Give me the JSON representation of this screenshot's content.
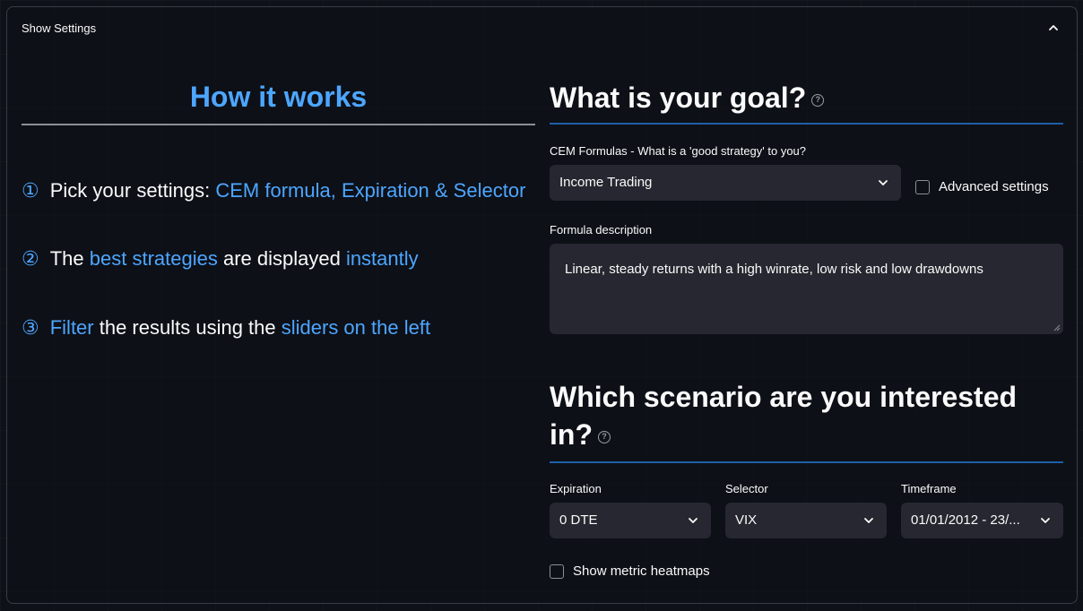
{
  "settings_panel": {
    "title": "Show Settings"
  },
  "how": {
    "title": "How it works",
    "steps": [
      {
        "num": "①",
        "parts": [
          "Pick your settings: ",
          "CEM formula, Expiration & Selector"
        ]
      },
      {
        "num": "②",
        "parts": [
          "The ",
          "best strategies",
          " are displayed ",
          "instantly"
        ]
      },
      {
        "num": "③",
        "parts": [
          "Filter",
          " the results using the ",
          "sliders on the left"
        ]
      }
    ]
  },
  "goal": {
    "heading": "What is your goal?",
    "help": "?",
    "formula_label": "CEM Formulas - What is a 'good strategy' to you?",
    "formula_value": "Income Trading",
    "advanced_label": "Advanced settings",
    "description_label": "Formula description",
    "description_text": "Linear, steady returns with a high winrate, low risk and low drawdowns"
  },
  "scenario": {
    "heading_line1": "Which scenario are you interested",
    "heading_line2": "in?",
    "help": "?",
    "expiration_label": "Expiration",
    "expiration_value": "0 DTE",
    "selector_label": "Selector",
    "selector_value": "VIX",
    "timeframe_label": "Timeframe",
    "timeframe_value": "01/01/2012 - 23/...",
    "heatmap_label": "Show metric heatmaps"
  },
  "colors": {
    "accent": "#4da6ff",
    "background": "#0e1117",
    "input": "#262730",
    "rule": "#1f5fa8"
  }
}
